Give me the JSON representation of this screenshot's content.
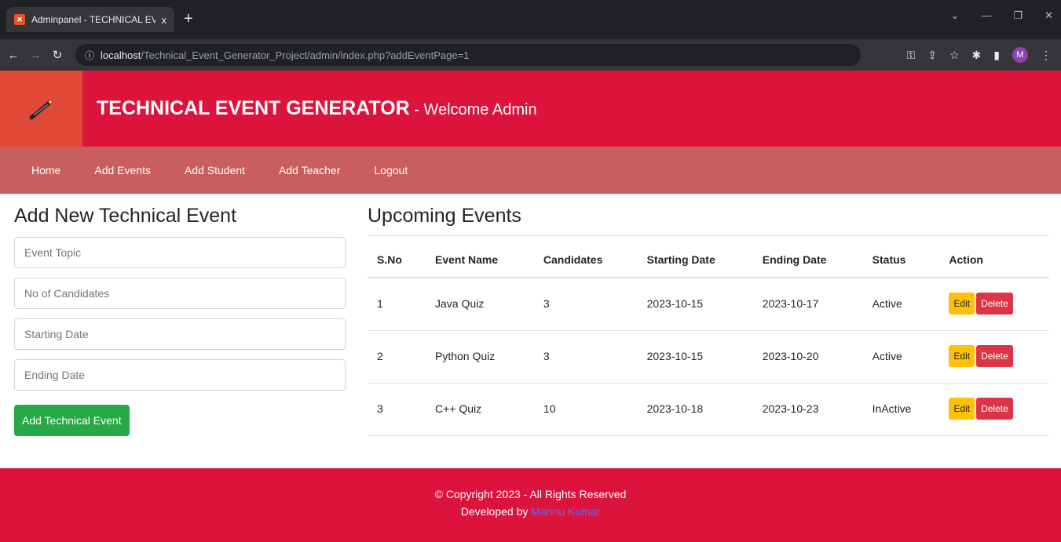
{
  "browser": {
    "tab_title": "Adminpanel - TECHNICAL EVEN",
    "tab_close": "x",
    "new_tab": "+",
    "url_host": "localhost",
    "url_path": "/Technical_Event_Generator_Project/admin/index.php?addEventPage=1",
    "profile_initial": "M"
  },
  "header": {
    "title": "TECHNICAL EVENT GENERATOR",
    "subtitle": " - Welcome Admin",
    "bg_color": "#dc143c"
  },
  "nav": {
    "items": [
      "Home",
      "Add Events",
      "Add Student",
      "Add Teacher",
      "Logout"
    ]
  },
  "form": {
    "heading": "Add New Technical Event",
    "topic_placeholder": "Event Topic",
    "candidates_placeholder": "No of Candidates",
    "start_placeholder": "Starting Date",
    "end_placeholder": "Ending Date",
    "submit_label": "Add Technical Event"
  },
  "events": {
    "heading": "Upcoming Events",
    "columns": [
      "S.No",
      "Event Name",
      "Candidates",
      "Starting Date",
      "Ending Date",
      "Status",
      "Action"
    ],
    "rows": [
      {
        "sno": "1",
        "name": "Java Quiz",
        "candidates": "3",
        "start": "2023-10-15",
        "end": "2023-10-17",
        "status": "Active"
      },
      {
        "sno": "2",
        "name": "Python Quiz",
        "candidates": "3",
        "start": "2023-10-15",
        "end": "2023-10-20",
        "status": "Active"
      },
      {
        "sno": "3",
        "name": "C++ Quiz",
        "candidates": "10",
        "start": "2023-10-18",
        "end": "2023-10-23",
        "status": "InActive"
      }
    ],
    "edit_label": "Edit",
    "delete_label": "Delete"
  },
  "footer": {
    "copyright": "© Copyright 2023 - All Rights Reserved",
    "developed_by": "Developed by",
    "developer": "Mannu Kumar"
  }
}
